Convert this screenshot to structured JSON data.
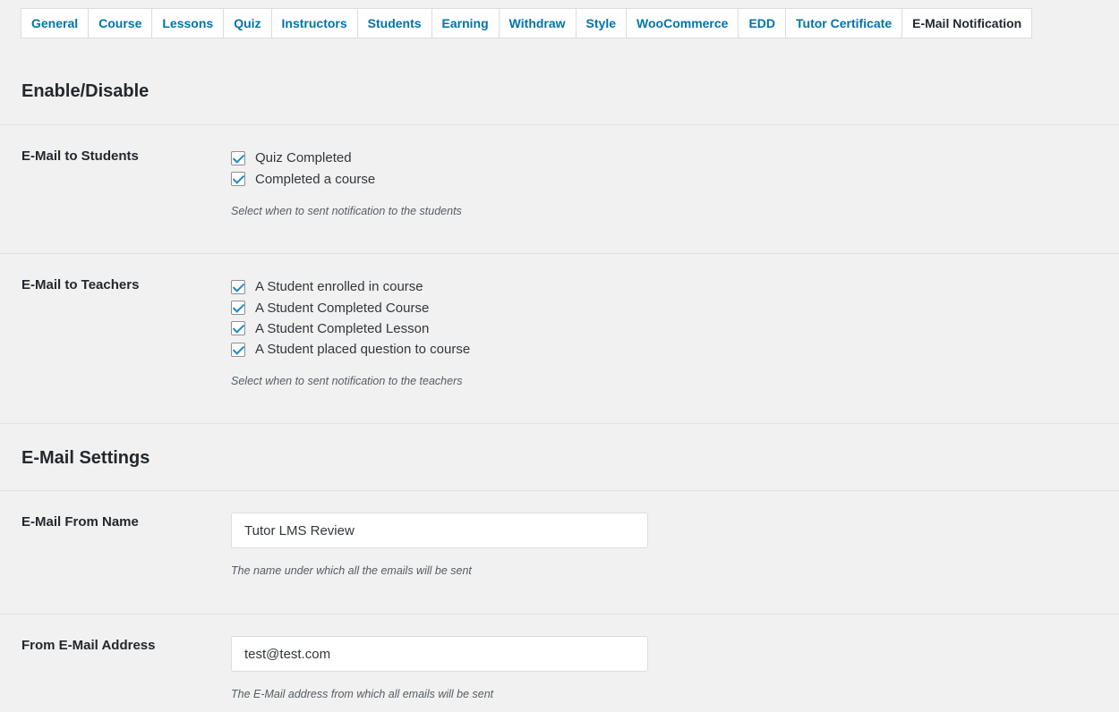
{
  "tabs": [
    {
      "label": "General"
    },
    {
      "label": "Course"
    },
    {
      "label": "Lessons"
    },
    {
      "label": "Quiz"
    },
    {
      "label": "Instructors"
    },
    {
      "label": "Students"
    },
    {
      "label": "Earning"
    },
    {
      "label": "Withdraw"
    },
    {
      "label": "Style"
    },
    {
      "label": "WooCommerce"
    },
    {
      "label": "EDD"
    },
    {
      "label": "Tutor Certificate"
    },
    {
      "label": "E-Mail Notification"
    }
  ],
  "active_tab": "E-Mail Notification",
  "colors": {
    "accent": "#0073aa",
    "checkmark": "#1e8cbe",
    "background": "#f1f1f1"
  },
  "enable_section": {
    "title": "Enable/Disable",
    "students": {
      "label": "E-Mail to Students",
      "options": [
        {
          "label": "Quiz Completed",
          "checked": true
        },
        {
          "label": "Completed a course",
          "checked": true
        }
      ],
      "hint": "Select when to sent notification to the students"
    },
    "teachers": {
      "label": "E-Mail to Teachers",
      "options": [
        {
          "label": "A Student enrolled in course",
          "checked": true
        },
        {
          "label": "A Student Completed Course",
          "checked": true
        },
        {
          "label": "A Student Completed Lesson",
          "checked": true
        },
        {
          "label": "A Student placed question to course",
          "checked": true
        }
      ],
      "hint": "Select when to sent notification to the teachers"
    }
  },
  "email_settings": {
    "title": "E-Mail Settings",
    "from_name": {
      "label": "E-Mail From Name",
      "value": "Tutor LMS Review",
      "hint": "The name under which all the emails will be sent"
    },
    "from_address": {
      "label": "From E-Mail Address",
      "value": "test@test.com",
      "hint": "The E-Mail address from which all emails will be sent"
    }
  }
}
